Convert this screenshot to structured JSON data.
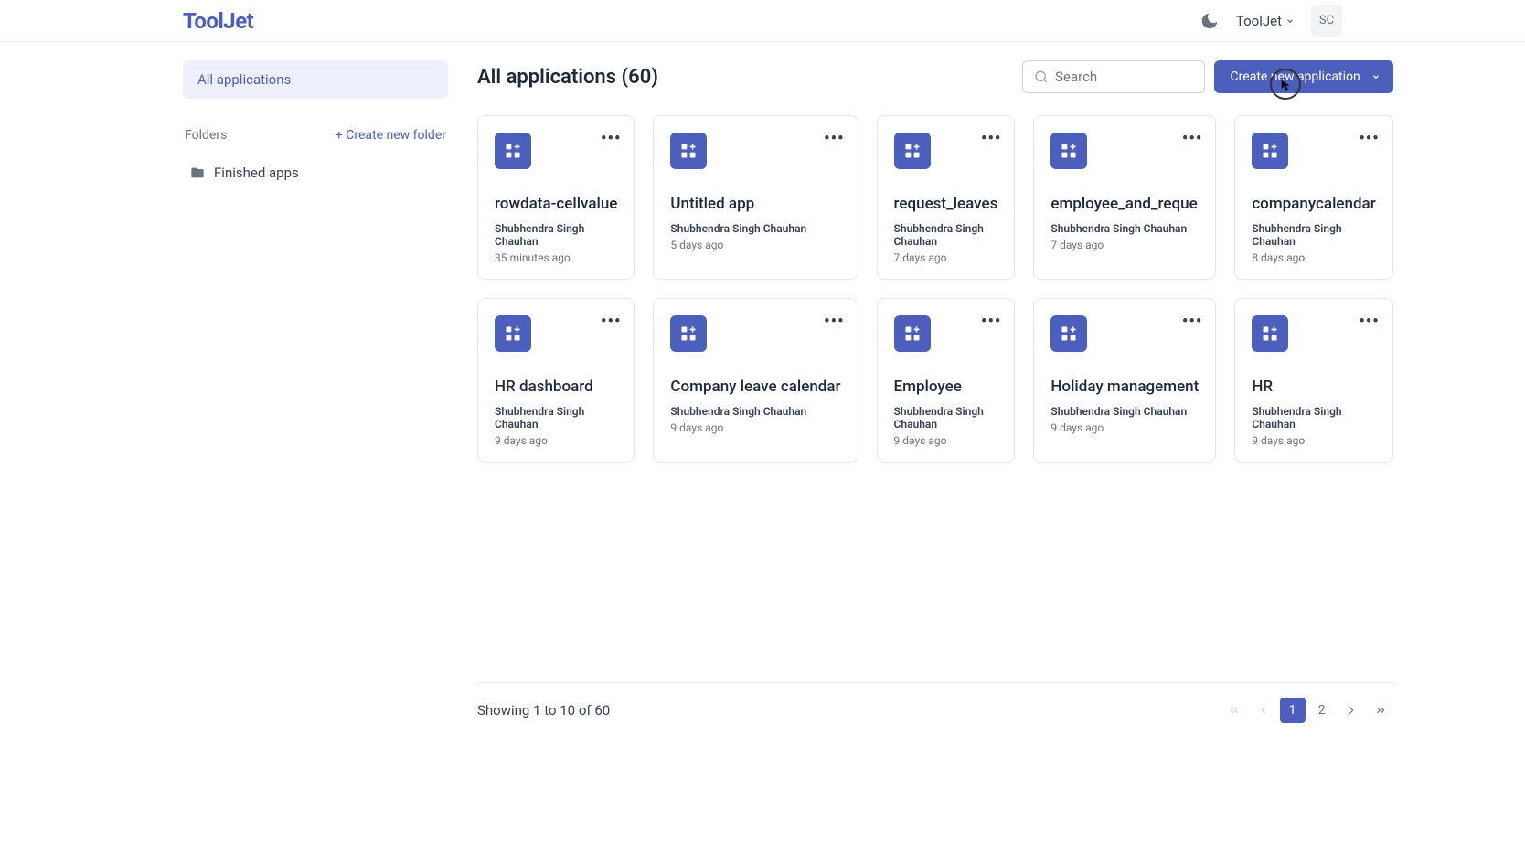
{
  "header": {
    "logo": "ToolJet",
    "workspace": "ToolJet",
    "avatar_initials": "SC"
  },
  "sidebar": {
    "all_apps": "All applications",
    "folders_label": "Folders",
    "create_folder": "+ Create new folder",
    "folders": [
      {
        "name": "Finished apps"
      }
    ]
  },
  "content": {
    "title": "All applications (60)",
    "search_placeholder": "Search",
    "create_btn": "Create new application"
  },
  "apps": [
    {
      "name": "rowdata-cellvalue",
      "author": "Shubhendra Singh Chauhan",
      "time": "35 minutes ago"
    },
    {
      "name": "Untitled app",
      "author": "Shubhendra Singh Chauhan",
      "time": "5 days ago"
    },
    {
      "name": "request_leaves",
      "author": "Shubhendra Singh Chauhan",
      "time": "7 days ago"
    },
    {
      "name": "employee_and_reque",
      "author": "Shubhendra Singh Chauhan",
      "time": "7 days ago"
    },
    {
      "name": "companycalendar",
      "author": "Shubhendra Singh Chauhan",
      "time": "8 days ago"
    },
    {
      "name": "HR dashboard",
      "author": "Shubhendra Singh Chauhan",
      "time": "9 days ago"
    },
    {
      "name": "Company leave calendar",
      "author": "Shubhendra Singh Chauhan",
      "time": "9 days ago"
    },
    {
      "name": "Employee",
      "author": "Shubhendra Singh Chauhan",
      "time": "9 days ago"
    },
    {
      "name": "Holiday management",
      "author": "Shubhendra Singh Chauhan",
      "time": "9 days ago"
    },
    {
      "name": "HR",
      "author": "Shubhendra Singh Chauhan",
      "time": "9 days ago"
    }
  ],
  "pagination": {
    "showing": "Showing 1 to 10 of 60",
    "pages": [
      "1",
      "2"
    ],
    "current": "1"
  }
}
